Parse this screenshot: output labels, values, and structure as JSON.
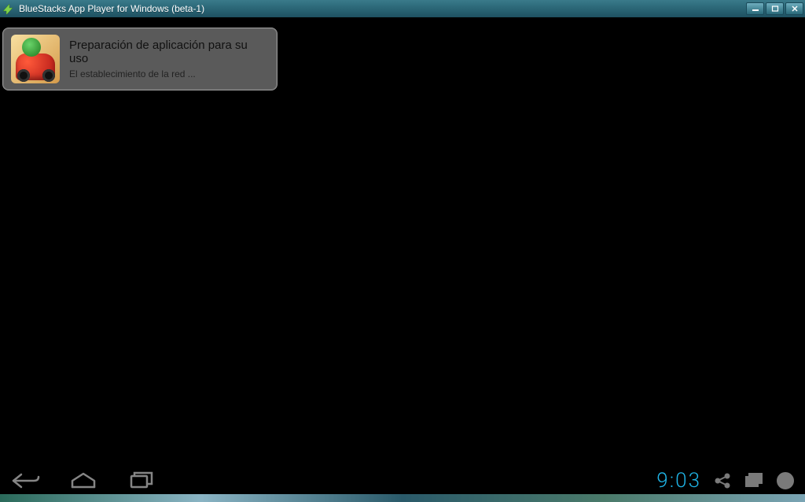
{
  "titlebar": {
    "title": "BlueStacks App Player for Windows (beta-1)"
  },
  "notification": {
    "title": "Preparación de aplicación para su uso",
    "subtitle": "El establecimiento de la red ..."
  },
  "navbar": {
    "clock": "9:03"
  }
}
